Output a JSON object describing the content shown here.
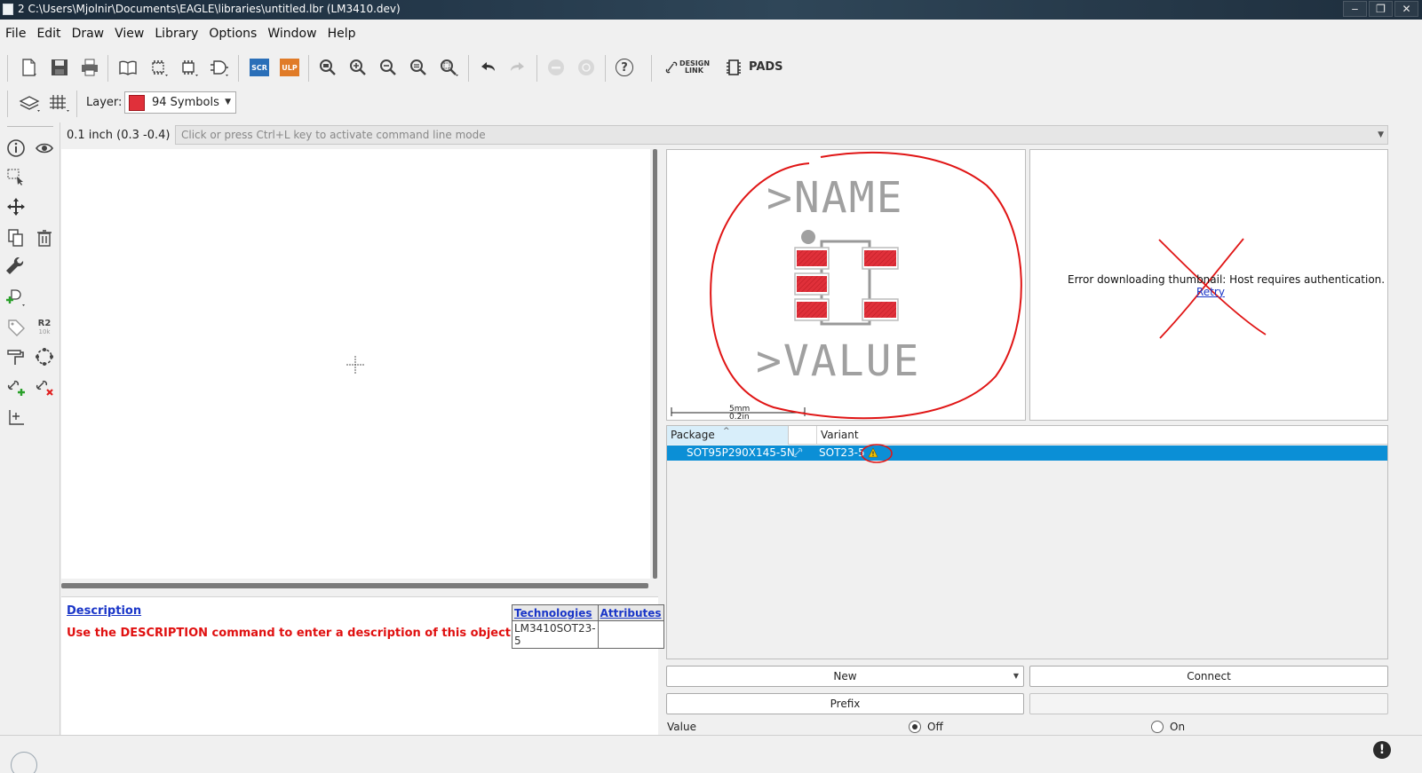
{
  "window": {
    "title": "2 C:\\Users\\Mjolnir\\Documents\\EAGLE\\libraries\\untitled.lbr (LM3410.dev)",
    "controls": [
      "‒",
      "❐",
      "✕"
    ]
  },
  "menu": [
    "File",
    "Edit",
    "Draw",
    "View",
    "Library",
    "Options",
    "Window",
    "Help"
  ],
  "toolbar": {
    "scr_label": "SCR",
    "ulp_label": "ULP",
    "design_link_line1": "DESIGN",
    "design_link_line2": "LINK",
    "pads_label": "PADS",
    "help_glyph": "?"
  },
  "layer": {
    "label": "Layer:",
    "selected": "94 Symbols",
    "color": "#e0303a"
  },
  "command": {
    "coordinates": "0.1 inch (0.3 -0.4)",
    "placeholder": "Click or press Ctrl+L key to activate command line mode"
  },
  "left_tools": {
    "r2_label": "R2",
    "r2_sub": "10k"
  },
  "description": {
    "heading": "Description",
    "text": "Use the DESCRIPTION command to enter a description of this object.",
    "table_headers": [
      "Technologies",
      "Attributes"
    ],
    "table_rows": [
      [
        "LM3410SOT23-5",
        ""
      ]
    ]
  },
  "preview": {
    "name_text": ">NAME",
    "value_text": ">VALUE",
    "scale_mm": "5mm",
    "scale_in": "0.2in"
  },
  "thumbnail": {
    "error": "Error downloading thumbnail: Host requires authentication.",
    "retry": "Retry"
  },
  "packages": {
    "headers": [
      "Package",
      "Variant"
    ],
    "sort_indicator": "^",
    "rows": [
      {
        "package": "SOT95P290X145-5N",
        "variant": "SOT23-5",
        "warning": true
      }
    ]
  },
  "buttons": {
    "new_label": "New",
    "connect_label": "Connect",
    "prefix_label": "Prefix"
  },
  "value_row": {
    "label": "Value",
    "off_label": "Off",
    "on_label": "On",
    "selected": "Off"
  },
  "status": {
    "alert_glyph": "!"
  },
  "colors": {
    "selection": "#0b8fd6",
    "pad_red": "#e0303a",
    "annotation_red": "#e01515",
    "link_blue": "#1a36c8"
  }
}
